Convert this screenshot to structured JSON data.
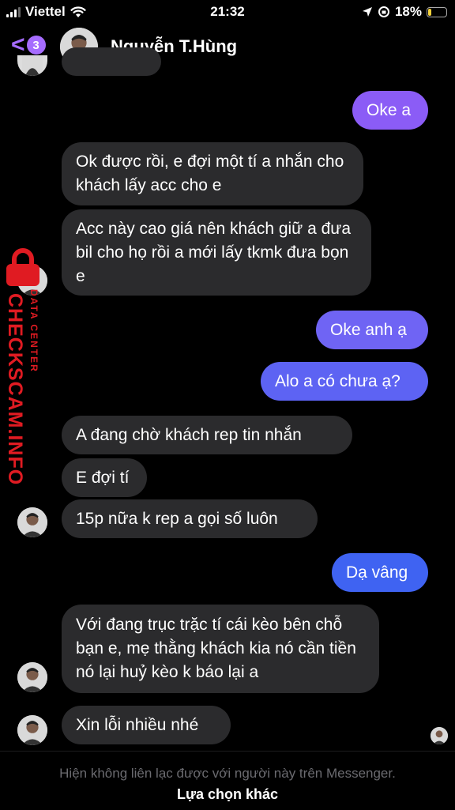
{
  "status_bar": {
    "carrier": "Viettel",
    "time": "21:32",
    "battery_text": "18%",
    "battery_level": 0.18
  },
  "header": {
    "unread_count": "3",
    "contact_name": "Nguyễn T.Hùng"
  },
  "messages": [
    {
      "side": "out",
      "text": "Oke a"
    },
    {
      "side": "in",
      "text": "Ok được rồi, e đợi một tí a nhắn cho khách lấy acc cho e"
    },
    {
      "side": "in",
      "text": "Acc này cao giá nên khách giữ a đưa bil cho họ rồi a mới lấy tkmk đưa bọn e"
    },
    {
      "side": "out",
      "text": "Oke anh ạ"
    },
    {
      "side": "out",
      "text": "Alo a có chưa ạ?"
    },
    {
      "side": "in",
      "text": "A đang chờ khách rep tin nhắn"
    },
    {
      "side": "in",
      "text": "E đợi tí"
    },
    {
      "side": "in",
      "text": "15p nữa k rep a gọi số luôn"
    },
    {
      "side": "out",
      "text": "Dạ vâng"
    },
    {
      "side": "in",
      "text": "Với đang trục trặc tí cái kèo bên chỗ bạn e, mẹ thằng khách kia nó cần tiền nó lại huỷ kèo k báo lại a"
    },
    {
      "side": "in",
      "text": "Xin lỗi nhiều nhé"
    }
  ],
  "watermark": {
    "main": "CHECKSCAM.INFO",
    "sub": "DATA CENTER"
  },
  "footer": {
    "notice": "Hiện không liên lạc được với người này trên Messenger.",
    "option": "Lựa chọn khác"
  },
  "colors": {
    "accent": "#a66cff",
    "incoming_bubble": "#2b2b2d",
    "watermark_red": "#e01b22"
  }
}
